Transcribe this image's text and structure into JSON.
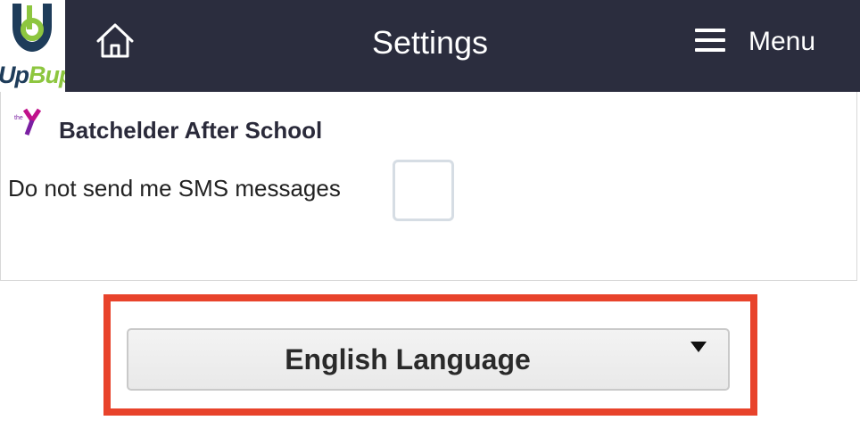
{
  "header": {
    "logo": {
      "text_up": "Up",
      "text_bup": "Bup",
      "icon": "upbup-logo-icon",
      "colors": {
        "navy": "#1e3c5a",
        "green": "#8dc63f"
      }
    },
    "home_icon": "home-icon",
    "title": "Settings",
    "menu_icon": "hamburger-menu-icon",
    "menu_label": "Menu",
    "background": "#2b2d3e"
  },
  "settings": {
    "org_logo_icon": "ymca-logo-icon",
    "org_name": "Batchelder After School",
    "sms_opt_out_label": "Do not send me SMS messages",
    "sms_opt_out_checked": false
  },
  "language": {
    "selected": "English Language",
    "highlight_color": "#e8432b"
  }
}
